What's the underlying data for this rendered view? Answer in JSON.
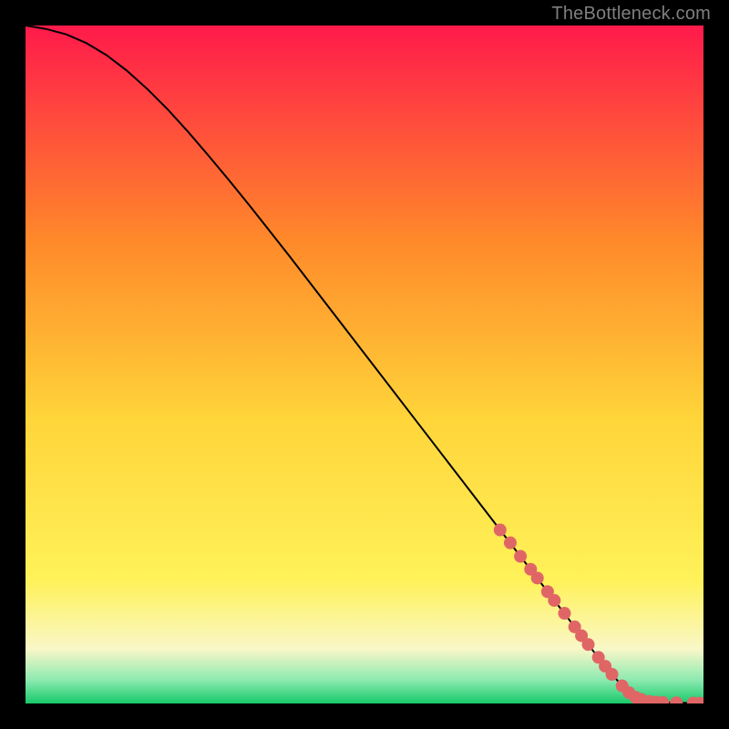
{
  "attribution": "TheBottleneck.com",
  "colors": {
    "background": "#000000",
    "attribution_text": "#7f7f7f",
    "curve": "#000000",
    "markers": "#e06666",
    "gradient_top": "#ff1a4b",
    "gradient_mid_upper": "#ff8a2a",
    "gradient_mid": "#ffd53a",
    "gradient_mid_lower": "#fff25a",
    "gradient_cream": "#f9f7c8",
    "gradient_mint": "#8deab0",
    "gradient_bottom": "#18c96b"
  },
  "chart_data": {
    "type": "line",
    "title": "",
    "xlabel": "",
    "ylabel": "",
    "xlim": [
      0,
      100
    ],
    "ylim": [
      0,
      100
    ],
    "series": [
      {
        "name": "curve",
        "x": [
          0,
          3,
          6,
          9,
          12,
          15,
          18,
          21,
          24,
          27,
          30,
          33,
          36,
          39,
          42,
          45,
          48,
          51,
          54,
          57,
          60,
          63,
          66,
          69,
          72,
          75,
          78,
          81,
          84,
          86,
          88,
          90,
          92,
          94,
          96,
          98,
          100
        ],
        "y": [
          100.0,
          99.5,
          98.7,
          97.4,
          95.6,
          93.3,
          90.6,
          87.6,
          84.3,
          80.8,
          77.2,
          73.5,
          69.7,
          65.9,
          62.0,
          58.1,
          54.2,
          50.3,
          46.4,
          42.5,
          38.6,
          34.7,
          30.8,
          26.9,
          23.0,
          19.1,
          15.2,
          11.3,
          7.4,
          4.9,
          2.6,
          0.9,
          0.3,
          0.15,
          0.1,
          0.07,
          0.05
        ]
      }
    ],
    "markers": [
      {
        "x": 70.0,
        "y": 25.6
      },
      {
        "x": 71.5,
        "y": 23.7
      },
      {
        "x": 73.0,
        "y": 21.7
      },
      {
        "x": 74.5,
        "y": 19.8
      },
      {
        "x": 75.5,
        "y": 18.5
      },
      {
        "x": 77.0,
        "y": 16.5
      },
      {
        "x": 78.0,
        "y": 15.2
      },
      {
        "x": 79.5,
        "y": 13.3
      },
      {
        "x": 81.0,
        "y": 11.3
      },
      {
        "x": 82.0,
        "y": 10.0
      },
      {
        "x": 83.0,
        "y": 8.7
      },
      {
        "x": 84.5,
        "y": 6.8
      },
      {
        "x": 85.5,
        "y": 5.5
      },
      {
        "x": 86.5,
        "y": 4.3
      },
      {
        "x": 88.0,
        "y": 2.6
      },
      {
        "x": 89.0,
        "y": 1.6
      },
      {
        "x": 90.0,
        "y": 0.9
      },
      {
        "x": 90.8,
        "y": 0.6
      },
      {
        "x": 92.0,
        "y": 0.3
      },
      {
        "x": 93.0,
        "y": 0.2
      },
      {
        "x": 94.0,
        "y": 0.15
      },
      {
        "x": 96.0,
        "y": 0.1
      },
      {
        "x": 98.5,
        "y": 0.07
      },
      {
        "x": 99.5,
        "y": 0.05
      }
    ]
  }
}
